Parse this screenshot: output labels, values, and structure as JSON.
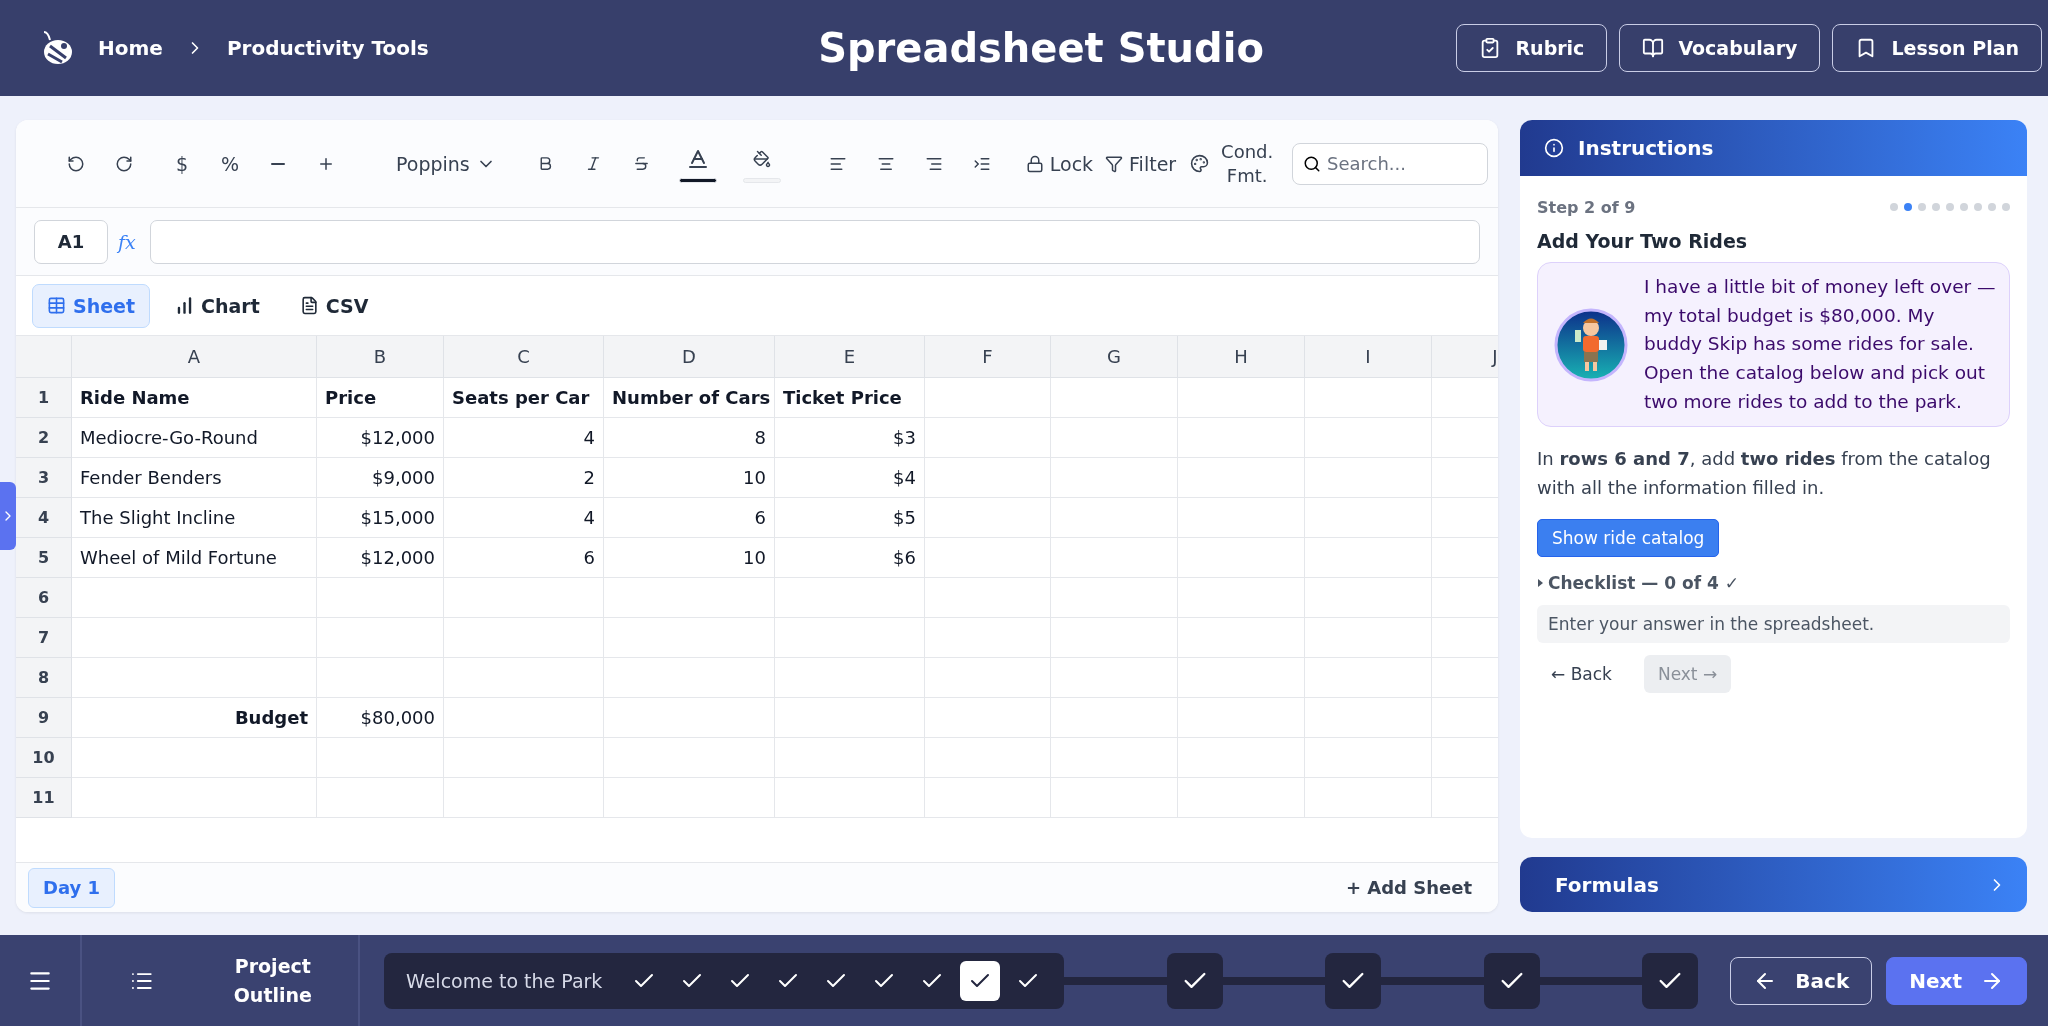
{
  "header": {
    "breadcrumbs": [
      {
        "label": "Home"
      },
      {
        "label": "Productivity Tools"
      }
    ],
    "title": "Spreadsheet Studio",
    "buttons": [
      {
        "label": "Rubric",
        "kind": "rubric"
      },
      {
        "label": "Vocabulary",
        "kind": "vocabulary"
      },
      {
        "label": "Lesson Plan",
        "kind": "plan"
      }
    ]
  },
  "toolbar": {
    "currency": "$",
    "percent": "%",
    "font": "Poppins",
    "lock": "Lock",
    "filter": "Filter",
    "cond_fmt": "Cond. Fmt.",
    "search_placeholder": "Search..."
  },
  "formula_bar": {
    "cell": "A1",
    "fx": "fx"
  },
  "view_tabs": [
    {
      "label": "Sheet",
      "kind": "sheet",
      "selected": true
    },
    {
      "label": "Chart",
      "kind": "chart",
      "selected": false
    },
    {
      "label": "CSV",
      "kind": "csv",
      "selected": false
    }
  ],
  "sheet": {
    "columns": [
      "A",
      "B",
      "C",
      "D",
      "E",
      "F",
      "G",
      "H",
      "I",
      "J"
    ],
    "rows": [
      {
        "num": "1",
        "kind": "header",
        "cells": [
          "Ride Name",
          "Price",
          "Seats per Car",
          "Number of Cars",
          "Ticket Price"
        ]
      },
      {
        "num": "2",
        "kind": "data",
        "cells": [
          "Mediocre-Go-Round",
          "$12,000",
          "4",
          "8",
          "$3"
        ]
      },
      {
        "num": "3",
        "kind": "data",
        "cells": [
          "Fender Benders",
          "$9,000",
          "2",
          "10",
          "$4"
        ]
      },
      {
        "num": "4",
        "kind": "data",
        "cells": [
          "The Slight Incline",
          "$15,000",
          "4",
          "6",
          "$5"
        ]
      },
      {
        "num": "5",
        "kind": "data",
        "cells": [
          "Wheel of Mild Fortune",
          "$12,000",
          "6",
          "10",
          "$6"
        ]
      },
      {
        "num": "6",
        "kind": "data"
      },
      {
        "num": "7",
        "kind": "data"
      },
      {
        "num": "8",
        "kind": "data"
      },
      {
        "num": "9",
        "kind": "total",
        "cells": [
          "Budget",
          "$80,000"
        ]
      },
      {
        "num": "10",
        "kind": "data"
      },
      {
        "num": "11",
        "kind": "data"
      }
    ]
  },
  "sheet_tabs": [
    {
      "label": "Day 1",
      "selected": true
    }
  ],
  "add_sheet": "+ Add Sheet",
  "instructions": {
    "title": "Instructions",
    "step": "Step 2 of 9",
    "steps": [
      {
        "selected": false
      },
      {
        "selected": true
      },
      {
        "selected": false
      },
      {
        "selected": false
      },
      {
        "selected": false
      },
      {
        "selected": false
      },
      {
        "selected": false
      },
      {
        "selected": false
      },
      {
        "selected": false
      }
    ],
    "heading": "Add Your Two Rides",
    "speech": "I have a little bit of money left over — my total budget is $80,000. My buddy Skip has some rides for sale. Open the catalog below and pick out two more rides to add to the park.",
    "task": "In **rows 6 and 7**, add **two rides** from the catalog with all the information filled in.",
    "catalog_button": "Show ride catalog",
    "checklist": {
      "label": "Checklist — 0 of 4 ✓",
      "expanded": false
    },
    "answer_hint": "Enter your answer in the spreadsheet.",
    "back": {
      "label": "← Back",
      "disabled": false
    },
    "next": {
      "label": "Next →",
      "disabled": true
    }
  },
  "formulas": {
    "title": "Formulas",
    "expanded": false
  },
  "footer": {
    "outline": "Project Outline",
    "lessons": [
      {
        "title": "Welcome to the Park",
        "steps": [
          {
            "done": true,
            "selected": false
          },
          {
            "done": true,
            "selected": false
          },
          {
            "done": true,
            "selected": false
          },
          {
            "done": true,
            "selected": false
          },
          {
            "done": true,
            "selected": false
          },
          {
            "done": true,
            "selected": false
          },
          {
            "done": true,
            "selected": false
          },
          {
            "done": true,
            "selected": true
          },
          {
            "done": true,
            "selected": false
          }
        ]
      },
      {
        "steps": [
          {
            "done": true
          }
        ]
      },
      {
        "steps": [
          {
            "done": true
          }
        ]
      },
      {
        "steps": [
          {
            "done": true
          }
        ]
      },
      {
        "steps": [
          {
            "done": true
          }
        ]
      }
    ],
    "back": "Back",
    "next": "Next"
  }
}
